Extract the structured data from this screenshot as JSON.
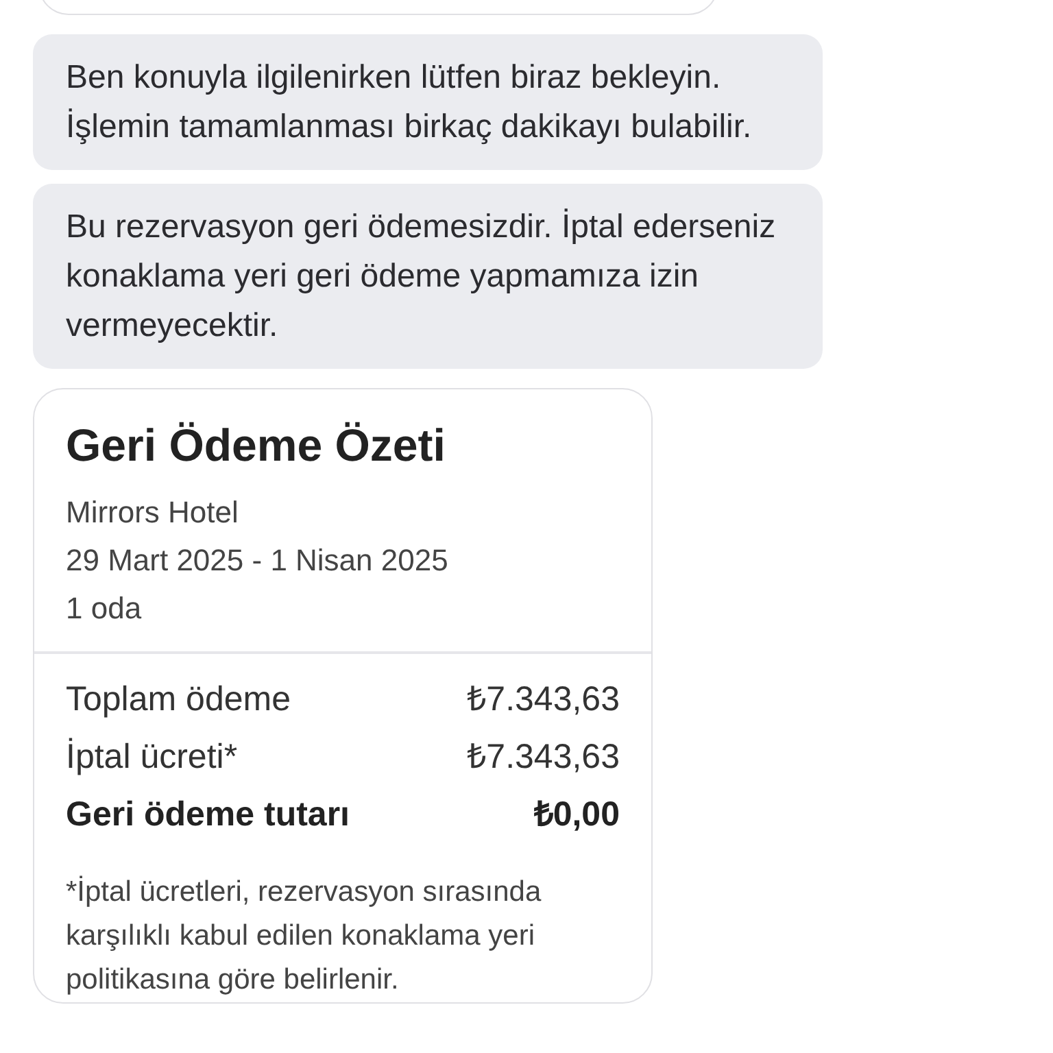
{
  "messages": [
    "Ben konuyla ilgilenirken lütfen biraz bekleyin. İşlemin tamamlanması birkaç dakikayı bulabilir.",
    "Bu rezervasyon geri ödemesizdir. İptal ederseniz konaklama yeri geri ödeme yapmamıza izin vermeyecektir."
  ],
  "summary": {
    "title": "Geri Ödeme Özeti",
    "details": [
      "Mirrors Hotel",
      "29 Mart 2025 - 1 Nisan 2025",
      "1 oda"
    ],
    "lines": [
      {
        "label": "Toplam ödeme",
        "amount": "₺7.343,63",
        "kind": "normal"
      },
      {
        "label": "İptal ücreti*",
        "amount": "₺7.343,63",
        "kind": "normal"
      },
      {
        "label": "Geri ödeme tutarı",
        "amount": "₺0,00",
        "kind": "total"
      }
    ],
    "footnote": "*İptal ücretleri, rezervasyon sırasında karşılıklı kabul edilen konaklama yeri politikasına göre belirlenir."
  }
}
